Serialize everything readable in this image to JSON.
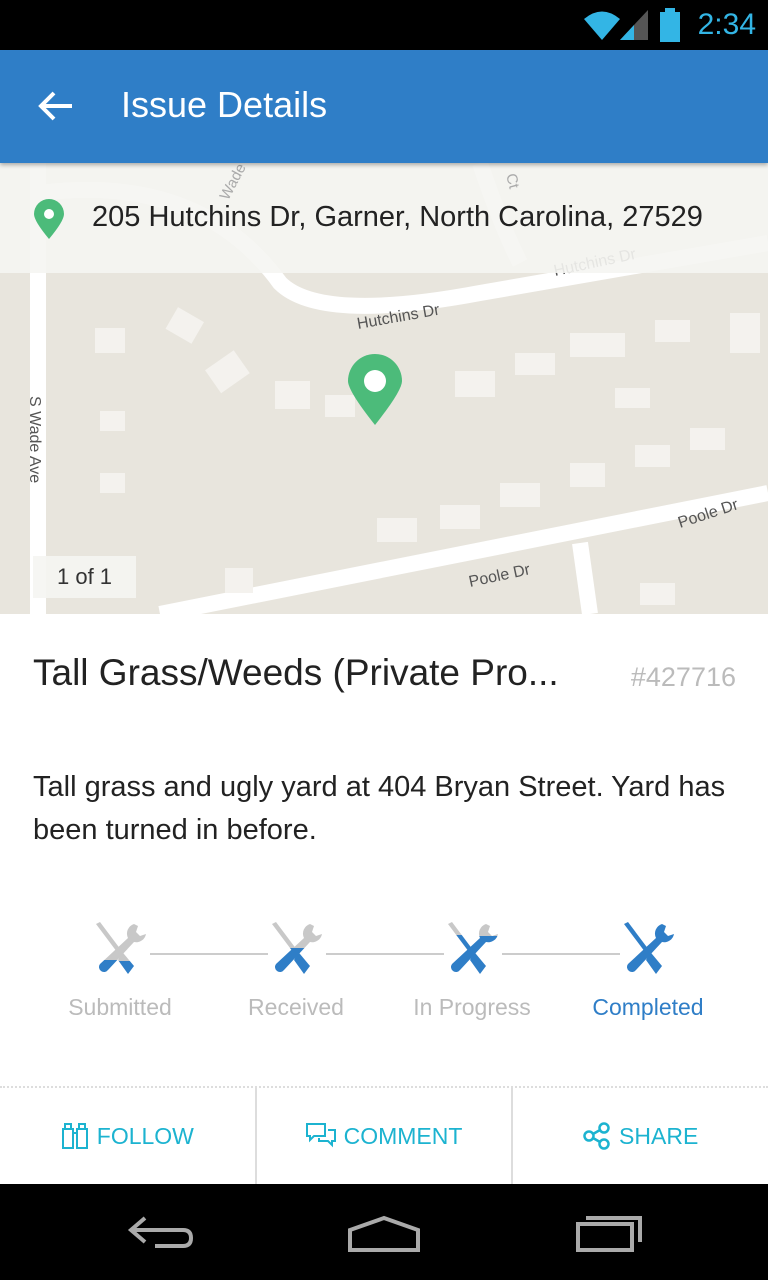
{
  "status_bar": {
    "time": "2:34"
  },
  "app_bar": {
    "title": "Issue Details"
  },
  "map": {
    "address": "205  Hutchins Dr, Garner, North Carolina, 27529",
    "counter": "1 of 1",
    "street_labels": [
      "Hutchins Dr",
      "Hutchins Dr",
      "S Wade Ave",
      "Poole Dr",
      "Poole Dr",
      "Wade Ct",
      "Ct"
    ]
  },
  "issue": {
    "title": "Tall Grass/Weeds (Private Pro...",
    "id": "#427716",
    "description": "Tall grass and ugly yard at 404 Bryan Street. Yard has been turned in before."
  },
  "progress": {
    "steps": [
      {
        "label": "Submitted",
        "fill": 0.25
      },
      {
        "label": "Received",
        "fill": 0.5
      },
      {
        "label": "In Progress",
        "fill": 0.75
      },
      {
        "label": "Completed",
        "fill": 1.0
      }
    ],
    "current": "Completed",
    "colors": {
      "active": "#2f7ec7",
      "inactive": "#c8c8c8"
    }
  },
  "actions": {
    "follow": "FOLLOW",
    "comment": "COMMENT",
    "share": "SHARE"
  },
  "colors": {
    "app_bar": "#2f7ec7",
    "action": "#1cb3d0",
    "pin": "#4cbb7a"
  }
}
